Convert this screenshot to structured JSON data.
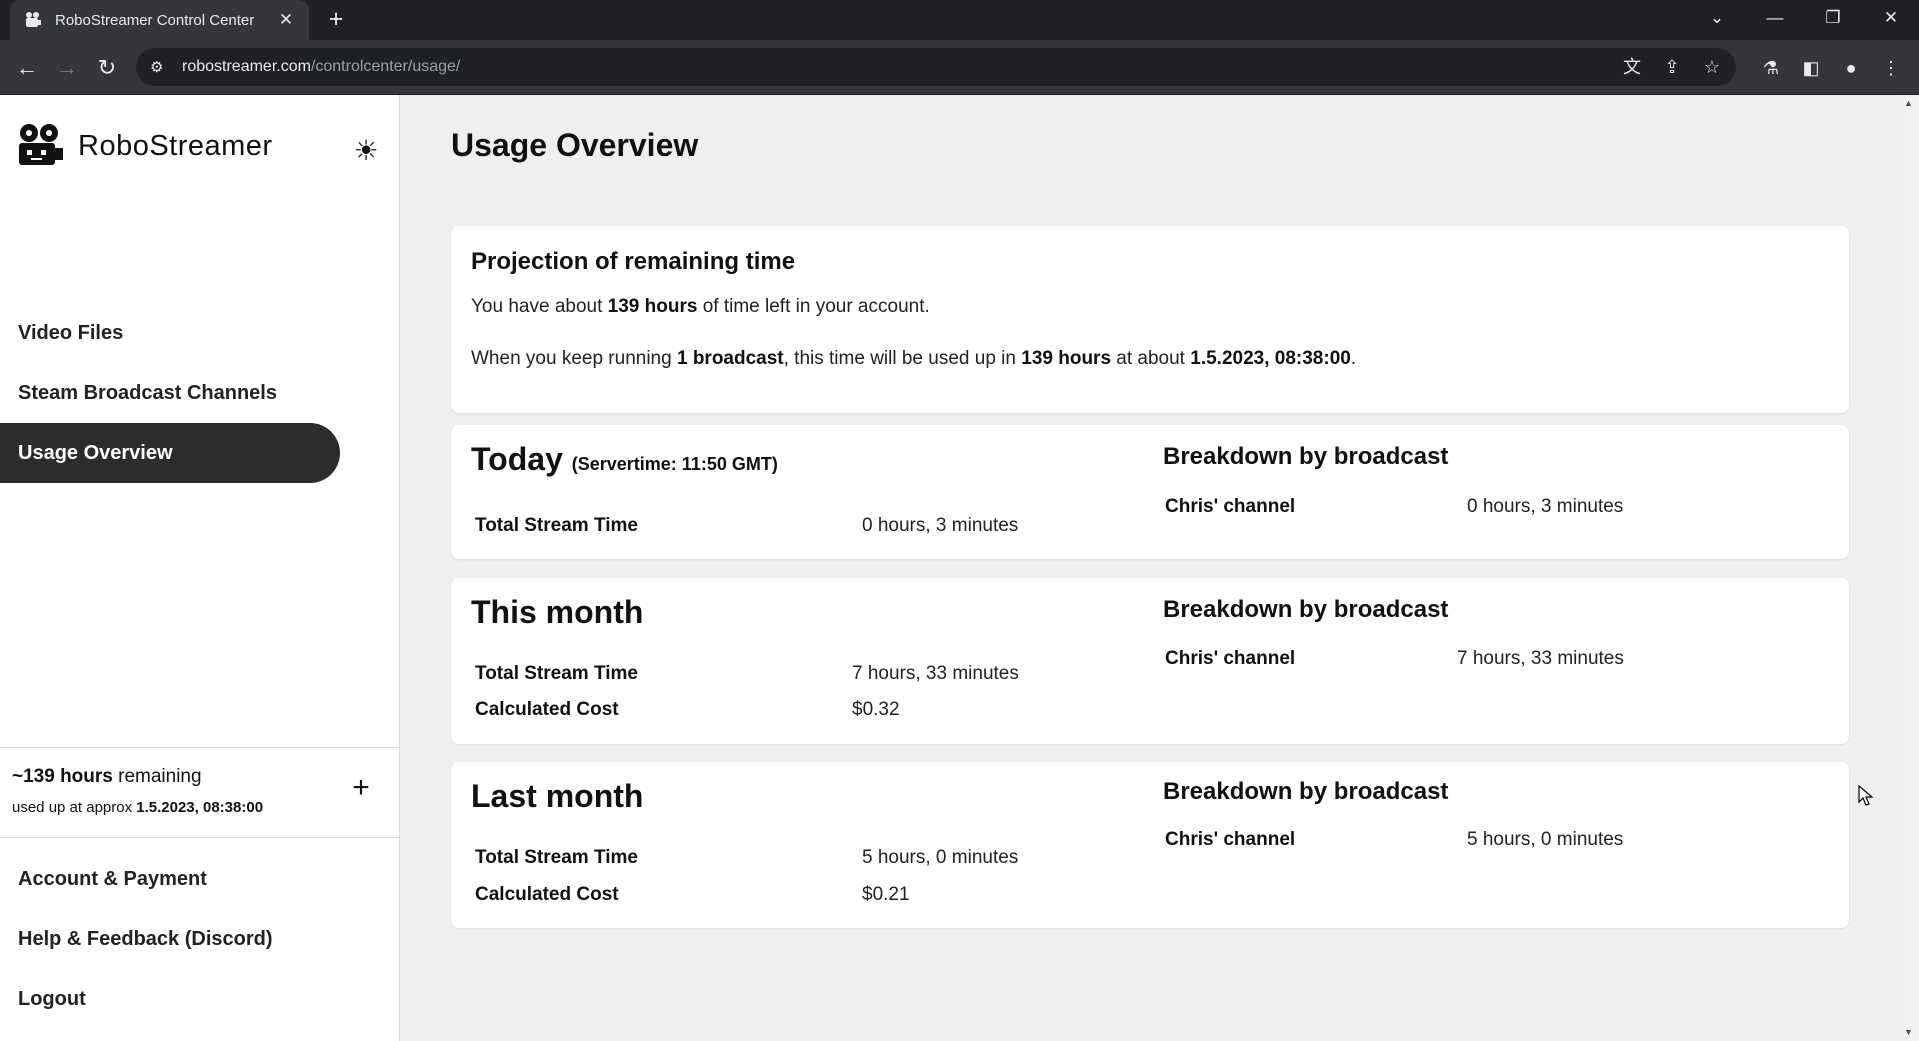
{
  "browser": {
    "tab_title": "RoboStreamer Control Center",
    "favicon": "robot-icon",
    "url_host": "robostreamer.com",
    "url_path": "/controlcenter/usage/"
  },
  "sidebar": {
    "brand_name": "RoboStreamer",
    "nav": [
      {
        "label": "Video Files"
      },
      {
        "label": "Steam Broadcast Channels"
      },
      {
        "label": "Usage Overview",
        "active": true
      }
    ],
    "remaining": {
      "hours": "~139 hours",
      "suffix": " remaining",
      "used_up_prefix": "used up at approx ",
      "used_up_date": "1.5.2023, 08:38:00"
    },
    "bottom_nav": [
      {
        "label": "Account & Payment"
      },
      {
        "label": "Help & Feedback (Discord)"
      },
      {
        "label": "Logout"
      }
    ]
  },
  "main": {
    "title": "Usage Overview",
    "projection": {
      "heading": "Projection of remaining time",
      "line1": {
        "a": "You have about ",
        "b": "139 hours",
        "c": " of time left in your account."
      },
      "line2": {
        "a": "When you keep running ",
        "b": "1 broadcast",
        "c": ", this time will be used up in ",
        "d": "139 hours",
        "e": " at about ",
        "f": "1.5.2023, 08:38:00",
        "g": "."
      }
    },
    "today": {
      "heading": "Today",
      "servertime": "(Servertime: 11:50 GMT)",
      "total_label": "Total Stream Time",
      "total_value": "0 hours, 3 minutes",
      "breakdown_title": "Breakdown by broadcast",
      "channel": "Chris' channel",
      "channel_value": "0 hours, 3 minutes"
    },
    "this_month": {
      "heading": "This month",
      "total_label": "Total Stream Time",
      "total_value": "7 hours, 33 minutes",
      "cost_label": "Calculated Cost",
      "cost_value": "$0.32",
      "breakdown_title": "Breakdown by broadcast",
      "channel": "Chris' channel",
      "channel_value": "7 hours, 33 minutes"
    },
    "last_month": {
      "heading": "Last month",
      "total_label": "Total Stream Time",
      "total_value": "5 hours, 0 minutes",
      "cost_label": "Calculated Cost",
      "cost_value": "$0.21",
      "breakdown_title": "Breakdown by broadcast",
      "channel": "Chris' channel",
      "channel_value": "5 hours, 0 minutes"
    }
  },
  "colors": {
    "active_nav_bg": "#2c2c2c",
    "page_bg": "#efefef",
    "card_bg": "#ffffff"
  }
}
